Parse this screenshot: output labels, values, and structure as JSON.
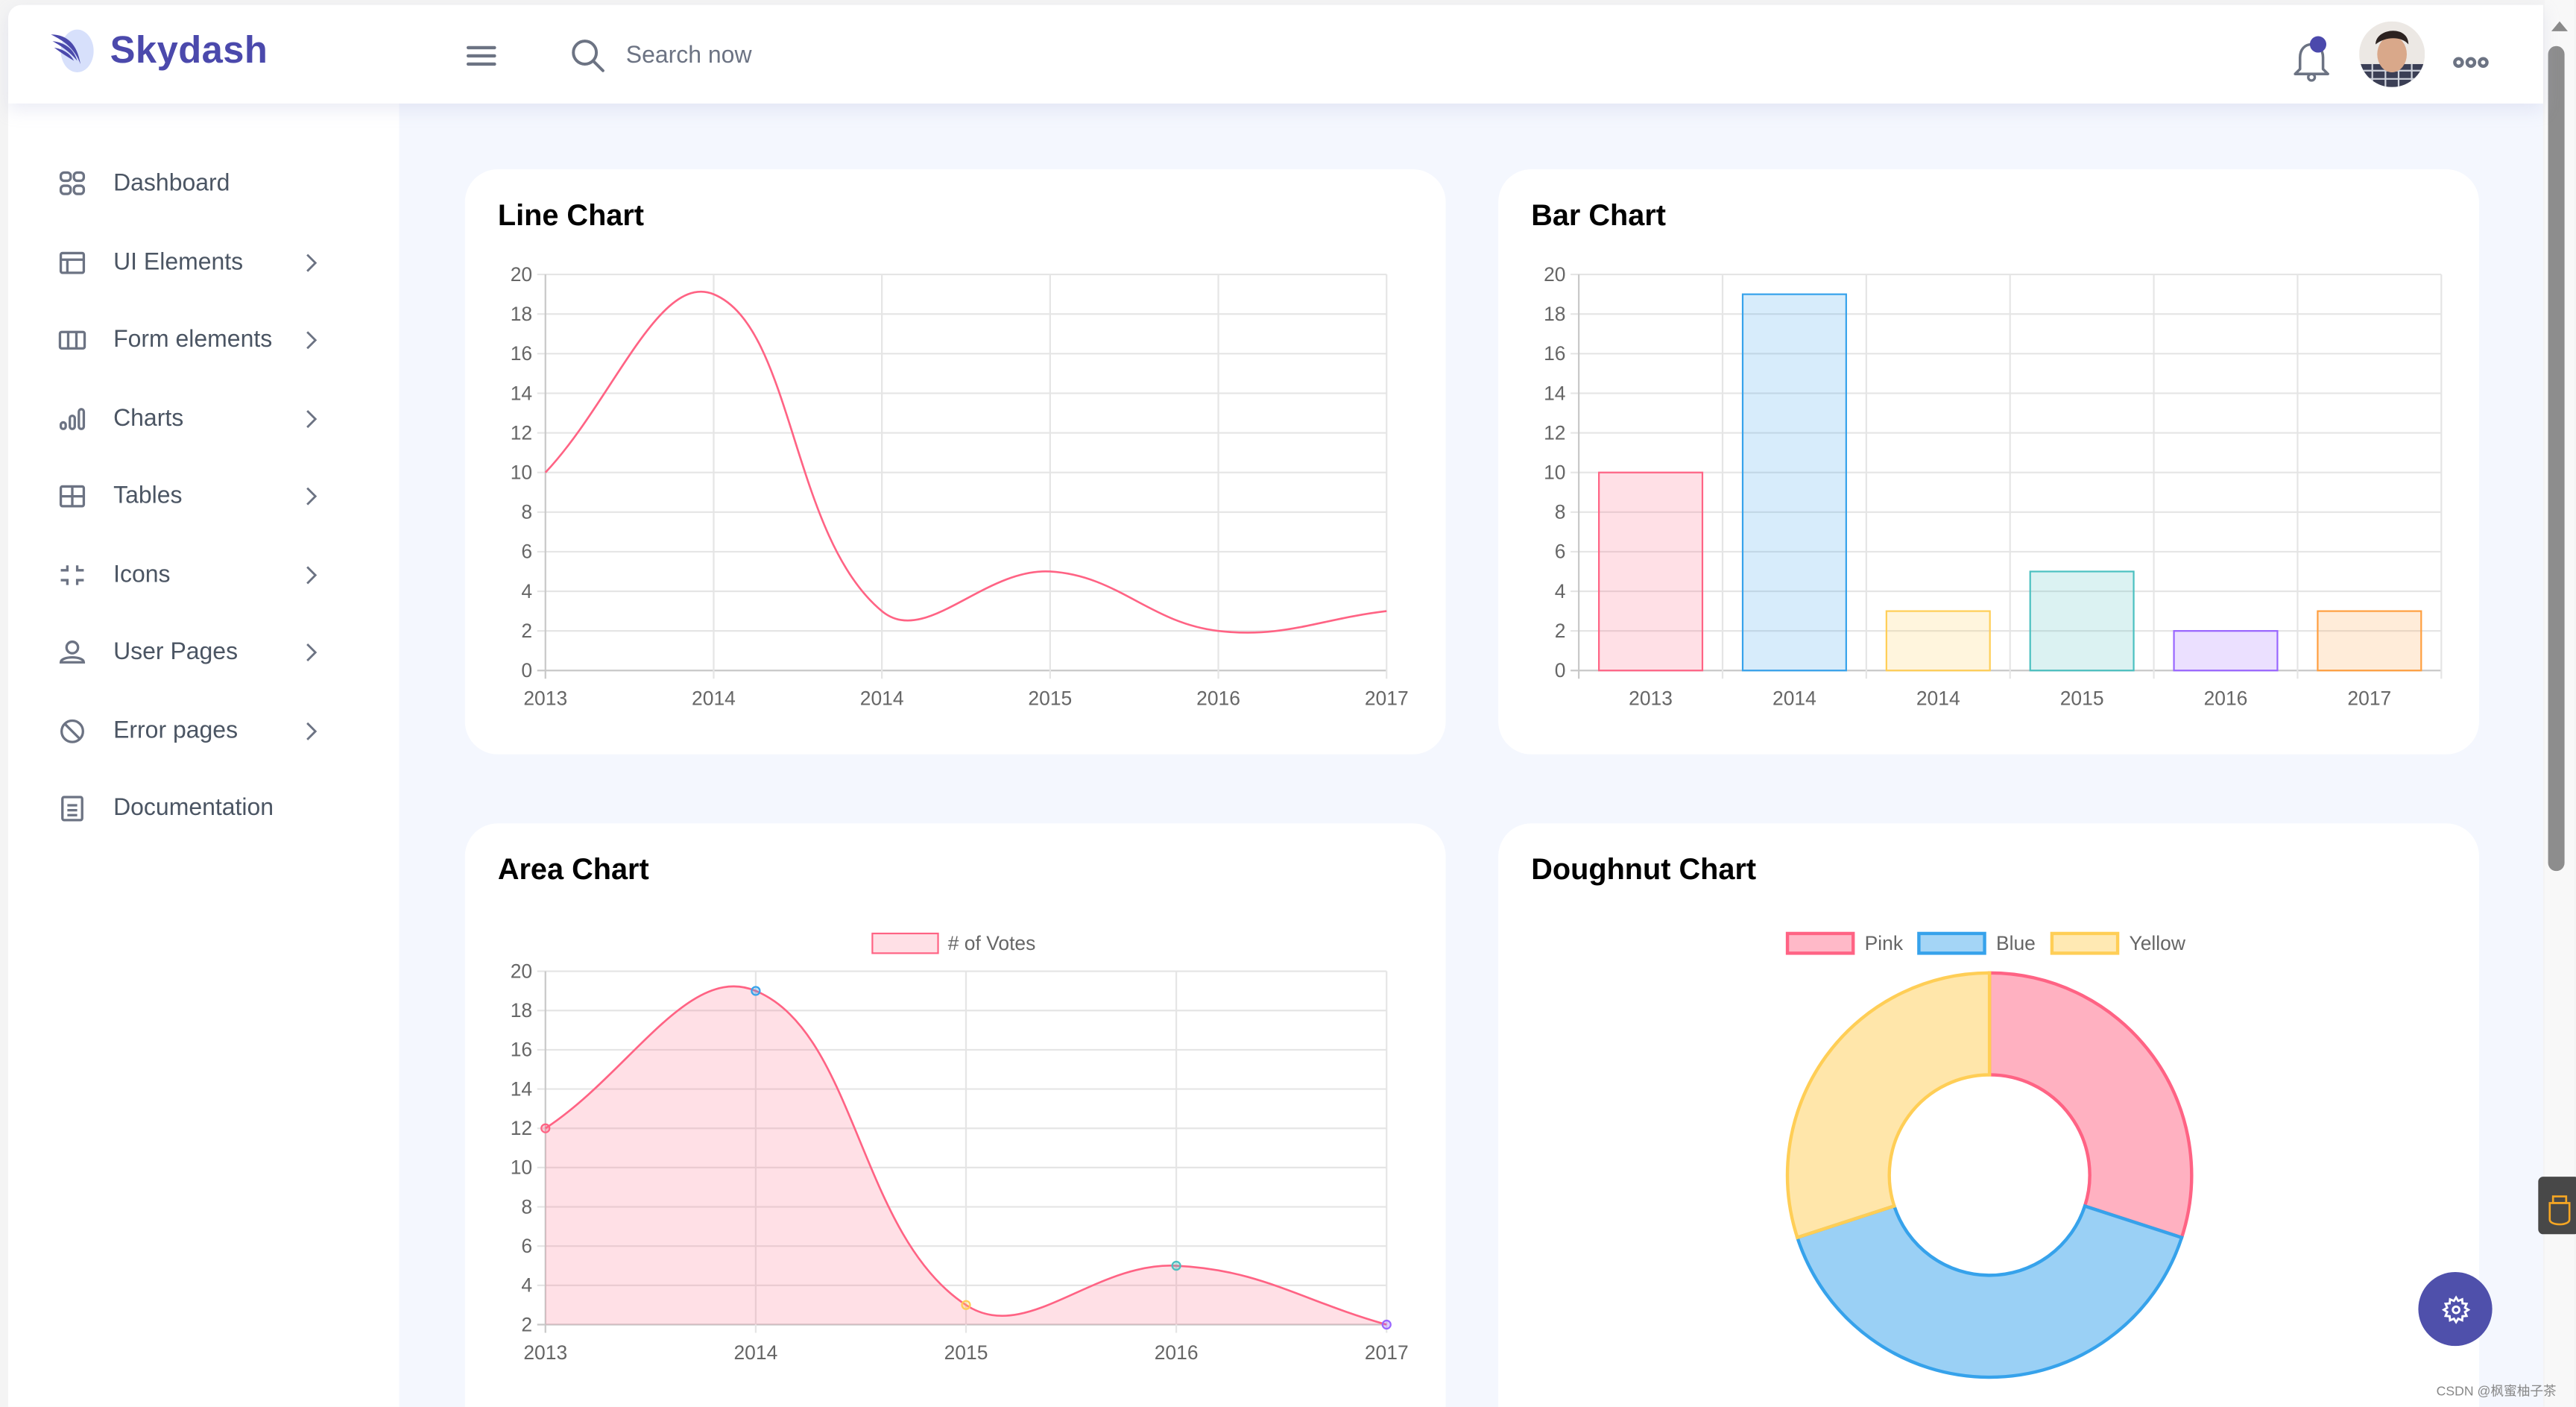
{
  "header": {
    "logo": "Skydash",
    "search_placeholder": "Search now",
    "notification_color": "#4b49ac"
  },
  "sidebar": {
    "items": [
      {
        "label": "Dashboard",
        "icon": "grid-icon",
        "has_arrow": false
      },
      {
        "label": "UI Elements",
        "icon": "layout-icon",
        "has_arrow": true
      },
      {
        "label": "Form elements",
        "icon": "columns-icon",
        "has_arrow": true
      },
      {
        "label": "Charts",
        "icon": "bar-chart-icon",
        "has_arrow": true
      },
      {
        "label": "Tables",
        "icon": "table-icon",
        "has_arrow": true
      },
      {
        "label": "Icons",
        "icon": "shrink-icon",
        "has_arrow": true
      },
      {
        "label": "User Pages",
        "icon": "user-icon",
        "has_arrow": true
      },
      {
        "label": "Error pages",
        "icon": "ban-icon",
        "has_arrow": true
      },
      {
        "label": "Documentation",
        "icon": "document-icon",
        "has_arrow": false
      }
    ]
  },
  "brand_color": "#4b49ac",
  "chart_data": [
    {
      "type": "line",
      "title": "Line Chart",
      "categories": [
        "2013",
        "2014",
        "2014",
        "2015",
        "2016",
        "2017"
      ],
      "values": [
        10,
        19,
        3,
        5,
        2,
        3
      ],
      "ylim": [
        0,
        20
      ],
      "yticks": [
        "0",
        "2",
        "4",
        "6",
        "8",
        "10",
        "12",
        "14",
        "16",
        "18",
        "20"
      ],
      "grid": true,
      "color": "#ff6384"
    },
    {
      "type": "bar",
      "title": "Bar Chart",
      "categories": [
        "2013",
        "2014",
        "2014",
        "2015",
        "2016",
        "2017"
      ],
      "values": [
        10,
        19,
        3,
        5,
        2,
        3
      ],
      "ylim": [
        0,
        20
      ],
      "yticks": [
        "0",
        "2",
        "4",
        "6",
        "8",
        "10",
        "12",
        "14",
        "16",
        "18",
        "20"
      ],
      "grid": true,
      "colors": [
        "#ff6384",
        "#36a2eb",
        "#ffce56",
        "#4bc0c0",
        "#9966ff",
        "#ff9f40"
      ]
    },
    {
      "type": "area",
      "title": "Area Chart",
      "legend": "# of Votes",
      "legend_position": "top",
      "categories": [
        "2013",
        "2014",
        "2015",
        "2016",
        "2017"
      ],
      "values": [
        12,
        19,
        3,
        5,
        2
      ],
      "ylim": [
        2,
        20
      ],
      "yticks": [
        "2",
        "4",
        "6",
        "8",
        "10",
        "12",
        "14",
        "16",
        "18",
        "20"
      ],
      "grid": true,
      "color": "#ff6384",
      "point_colors": [
        "#ff6384",
        "#36a2eb",
        "#ffce56",
        "#4bc0c0",
        "#9966ff"
      ]
    },
    {
      "type": "pie",
      "variant": "doughnut",
      "title": "Doughnut Chart",
      "legend_position": "top",
      "categories": [
        "Pink",
        "Blue",
        "Yellow"
      ],
      "values": [
        30,
        40,
        30
      ],
      "colors": [
        "#ff6384",
        "#36a2eb",
        "#ffce56"
      ]
    }
  ],
  "watermark": "CSDN @枫蜜柚子茶"
}
